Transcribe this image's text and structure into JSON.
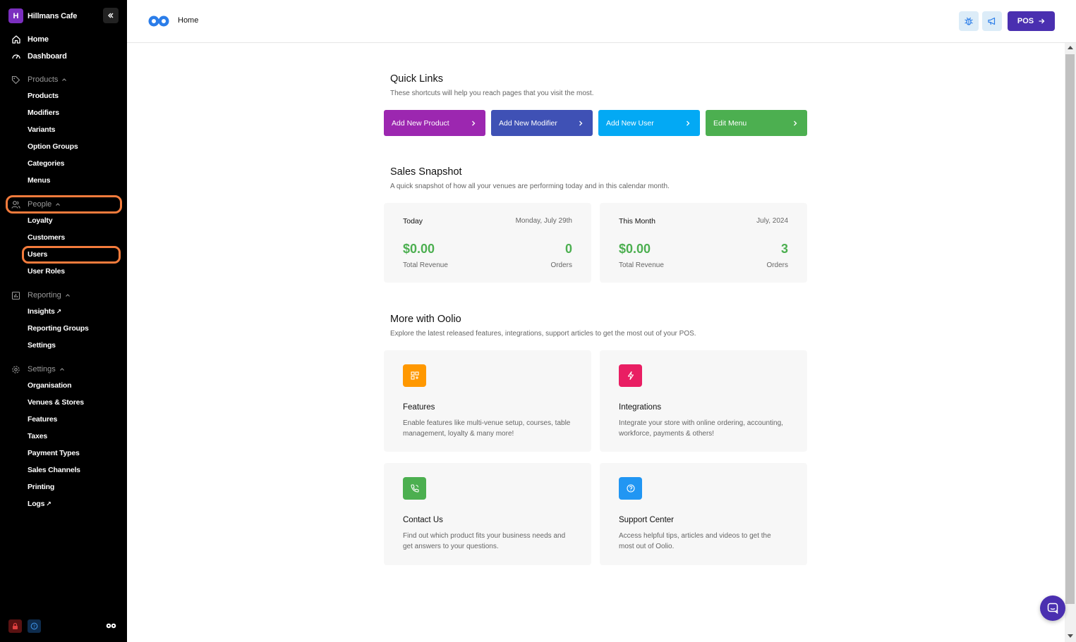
{
  "app": {
    "org_initial": "H",
    "org_name": "Hillmans Cafe"
  },
  "sidebar": {
    "top": [
      {
        "label": "Home",
        "icon": "home-icon"
      },
      {
        "label": "Dashboard",
        "icon": "dashboard-icon"
      }
    ],
    "sections": [
      {
        "label": "Products",
        "icon": "tag-icon",
        "items": [
          "Products",
          "Modifiers",
          "Variants",
          "Option Groups",
          "Categories",
          "Menus"
        ]
      },
      {
        "label": "People",
        "icon": "people-icon",
        "items": [
          "Loyalty",
          "Customers",
          "Users",
          "User Roles"
        ]
      },
      {
        "label": "Reporting",
        "icon": "report-icon",
        "items": [
          "Insights",
          "Reporting Groups",
          "Settings"
        ]
      },
      {
        "label": "Settings",
        "icon": "gear-icon",
        "items": [
          "Organisation",
          "Venues & Stores",
          "Features",
          "Taxes",
          "Payment Types",
          "Sales Channels",
          "Printing",
          "Logs"
        ]
      }
    ],
    "external_marker": "↗"
  },
  "topbar": {
    "breadcrumb": "Home",
    "pos_label": "POS"
  },
  "quick_links": {
    "title": "Quick Links",
    "subtitle": "These shortcuts will help you reach pages that you visit the most.",
    "links": [
      {
        "label": "Add New Product",
        "color": "#9c27b0"
      },
      {
        "label": "Add New Modifier",
        "color": "#3f51b5"
      },
      {
        "label": "Add New User",
        "color": "#03a9f4"
      },
      {
        "label": "Edit Menu",
        "color": "#4caf50"
      }
    ]
  },
  "sales_snapshot": {
    "title": "Sales Snapshot",
    "subtitle": "A quick snapshot of how all your venues are performing today and in this calendar month.",
    "cards": [
      {
        "label": "Today",
        "date": "Monday, July 29th",
        "revenue": "$0.00",
        "revenue_label": "Total Revenue",
        "orders": "0",
        "orders_label": "Orders"
      },
      {
        "label": "This Month",
        "date": "July, 2024",
        "revenue": "$0.00",
        "revenue_label": "Total Revenue",
        "orders": "3",
        "orders_label": "Orders"
      }
    ]
  },
  "more": {
    "title": "More with Oolio",
    "subtitle": "Explore the latest released features, integrations, support articles to get the most out of your POS.",
    "cards": [
      {
        "title": "Features",
        "desc": "Enable features like multi-venue setup, courses, table management, loyalty & many more!",
        "color": "#ff9800",
        "icon": "grid-plus-icon"
      },
      {
        "title": "Integrations",
        "desc": "Integrate your store with online ordering, accounting, workforce, payments & others!",
        "color": "#e91e63",
        "icon": "lightning-icon"
      },
      {
        "title": "Contact Us",
        "desc": "Find out which product fits your business needs and get answers to your questions.",
        "color": "#4caf50",
        "icon": "phone-icon"
      },
      {
        "title": "Support Center",
        "desc": "Access helpful tips, articles and videos to get the most out of Oolio.",
        "color": "#2196f3",
        "icon": "help-circle-icon"
      }
    ]
  }
}
